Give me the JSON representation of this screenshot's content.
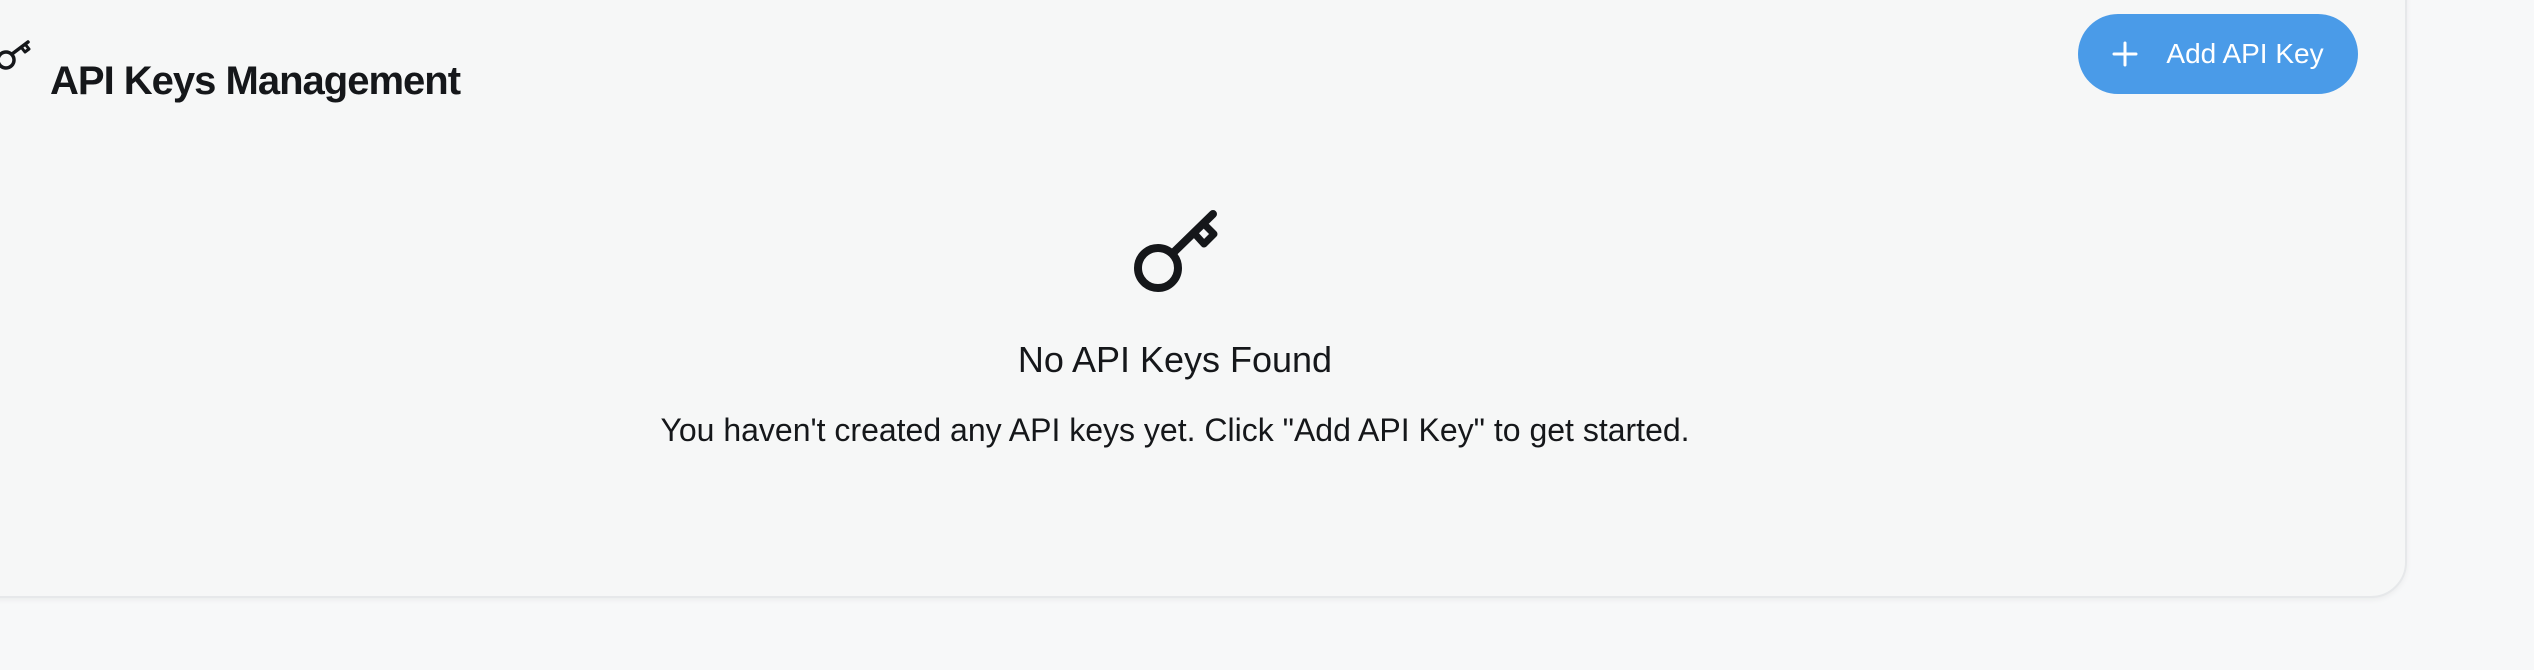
{
  "header": {
    "title": "API Keys Management",
    "add_button_label": "Add API Key"
  },
  "empty_state": {
    "title": "No API Keys Found",
    "description": "You haven't created any API keys yet. Click \"Add API Key\" to get started."
  },
  "icons": {
    "title_icon": "key-icon",
    "add_icon": "plus-icon",
    "empty_icon": "key-icon"
  },
  "colors": {
    "accent": "#4a9be8",
    "text": "#15171a",
    "card_background": "#f6f7f7",
    "page_background": "#f7f8f9"
  }
}
